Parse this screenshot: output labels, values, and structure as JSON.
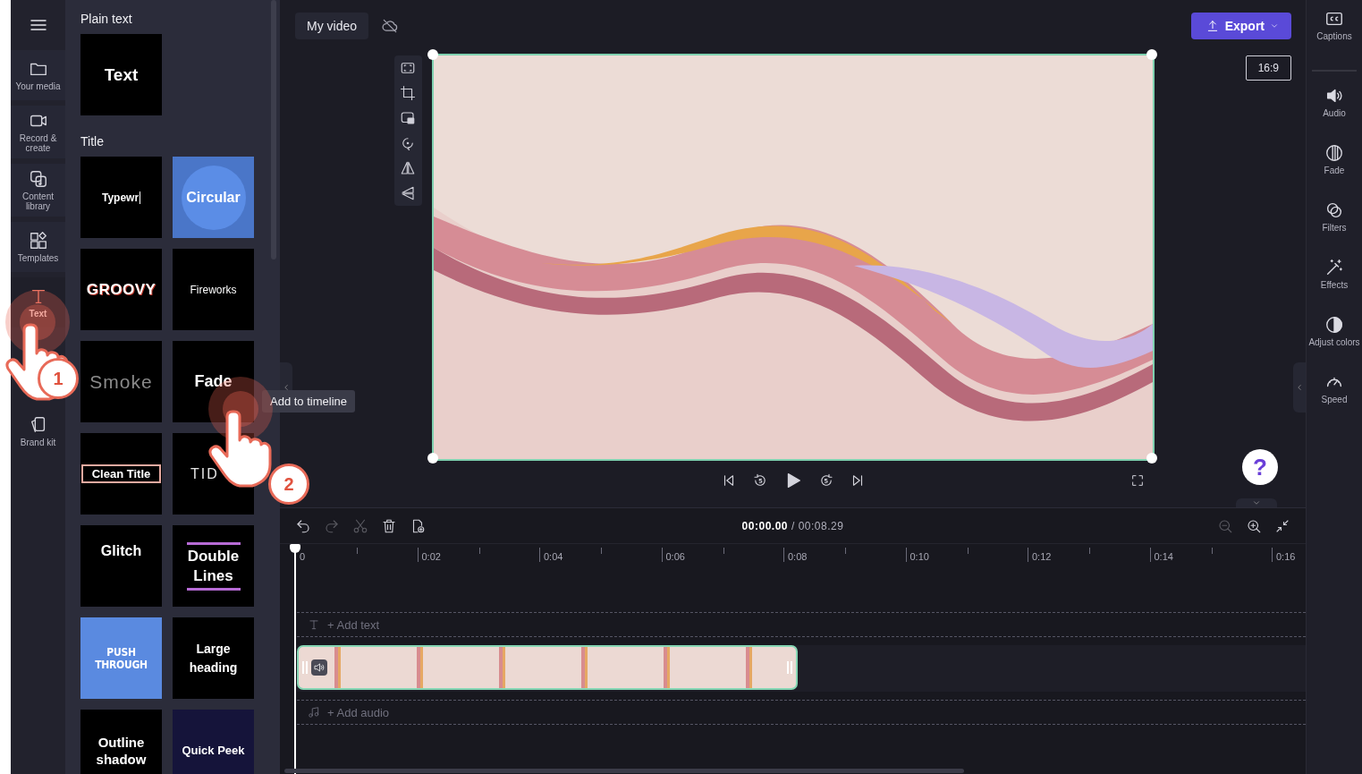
{
  "nav": {
    "items": [
      {
        "label": "Your media",
        "selected": false
      },
      {
        "label": "Record & create",
        "selected": false
      },
      {
        "label": "Content library",
        "selected": false
      },
      {
        "label": "Templates",
        "selected": false
      },
      {
        "label": "Text",
        "selected": true
      },
      {
        "label": "Brand kit",
        "selected": false
      }
    ]
  },
  "panel": {
    "sections": [
      {
        "title": "Plain text",
        "tiles": [
          {
            "label": "Text",
            "kind": "plain"
          }
        ]
      },
      {
        "title": "Title",
        "tiles": [
          {
            "label": "Typewr",
            "kind": "typewriter"
          },
          {
            "label": "Circular",
            "kind": "circular"
          },
          {
            "label": "GROOVY",
            "kind": "groovy"
          },
          {
            "label": "Fireworks",
            "kind": "fireworks"
          },
          {
            "label": "Smoke",
            "kind": "smoke"
          },
          {
            "label": "Fade",
            "kind": "fade"
          },
          {
            "label": "Clean Title",
            "kind": "clean"
          },
          {
            "label": "TID",
            "kind": "tidal"
          },
          {
            "label": "Glitch",
            "kind": "glitch"
          },
          {
            "label": "Double Lines",
            "kind": "double"
          },
          {
            "label": "PUSH THROUGH",
            "kind": "push"
          },
          {
            "label": "Large heading",
            "kind": "large"
          },
          {
            "label": "Outline shadow",
            "kind": "outline"
          },
          {
            "label": "Quick Peek",
            "kind": "peek"
          }
        ]
      }
    ]
  },
  "tooltip": "Add to timeline",
  "project": {
    "title": "My video"
  },
  "export": {
    "label": "Export"
  },
  "aspect_ratio": "16:9",
  "help": "?",
  "timeline": {
    "tools": [
      {
        "disabled": false
      },
      {
        "disabled": true
      },
      {
        "disabled": true
      },
      {
        "disabled": false
      },
      {
        "disabled": false
      }
    ],
    "current_time": "00:00.00",
    "total_time": "/ 00:08.29",
    "zoom_tools": [
      {
        "disabled": true
      },
      {
        "disabled": false
      },
      {
        "disabled": false
      }
    ],
    "ruler": [
      "0",
      "0:02",
      "0:04",
      "0:06",
      "0:08",
      "0:10",
      "0:12",
      "0:14",
      "0:16"
    ],
    "text_track": "+ Add text",
    "audio_track": "+ Add audio"
  },
  "rail": {
    "items": [
      {
        "label": "Captions"
      },
      {
        "label": "Audio"
      },
      {
        "label": "Fade"
      },
      {
        "label": "Filters"
      },
      {
        "label": "Effects"
      },
      {
        "label": "Adjust colors"
      },
      {
        "label": "Speed"
      }
    ]
  },
  "tutorial_steps": [
    {
      "number": "1"
    },
    {
      "number": "2"
    }
  ]
}
